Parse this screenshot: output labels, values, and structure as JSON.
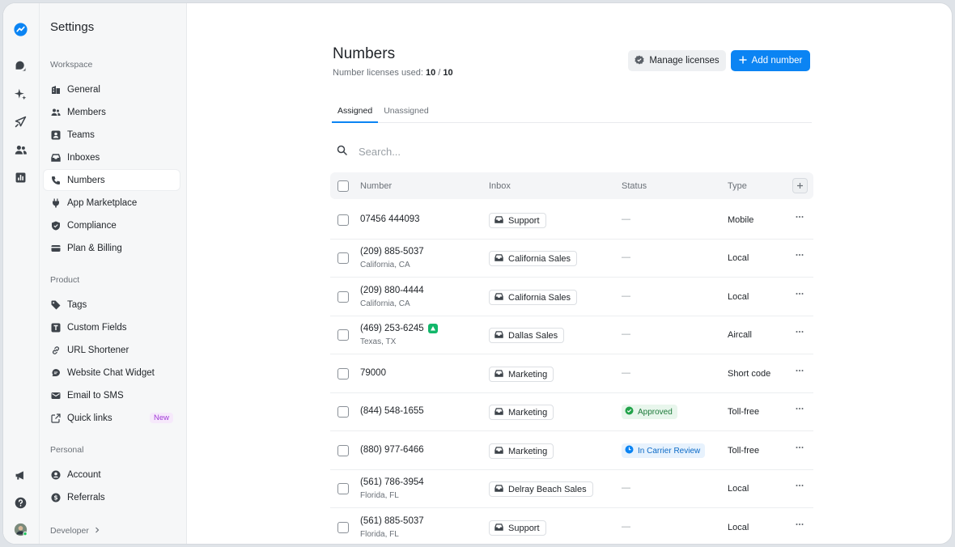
{
  "colors": {
    "accent": "#0b84f3",
    "approved": "#1d7a3a",
    "review": "#0b6ac7",
    "aircall": "#12b76a"
  },
  "rail": {
    "top_icons": [
      "app-logo-icon",
      "chat-bubbles-icon",
      "sparkle-icon",
      "rocket-icon",
      "contacts-icon",
      "analytics-icon"
    ],
    "bottom_icons": [
      "megaphone-icon",
      "help-icon",
      "user-avatar"
    ]
  },
  "sidebar": {
    "title": "Settings",
    "workspace_label": "Workspace",
    "workspace_items": [
      {
        "label": "General",
        "icon": "building-icon"
      },
      {
        "label": "Members",
        "icon": "members-icon"
      },
      {
        "label": "Teams",
        "icon": "teams-icon"
      },
      {
        "label": "Inboxes",
        "icon": "inbox-icon"
      },
      {
        "label": "Numbers",
        "icon": "phone-icon",
        "active": true
      },
      {
        "label": "App Marketplace",
        "icon": "plug-icon"
      },
      {
        "label": "Compliance",
        "icon": "shield-icon"
      },
      {
        "label": "Plan & Billing",
        "icon": "card-icon"
      }
    ],
    "product_label": "Product",
    "product_items": [
      {
        "label": "Tags",
        "icon": "tag-icon"
      },
      {
        "label": "Custom Fields",
        "icon": "custom-field-icon"
      },
      {
        "label": "URL Shortener",
        "icon": "link-icon"
      },
      {
        "label": "Website Chat Widget",
        "icon": "chat-widget-icon"
      },
      {
        "label": "Email to SMS",
        "icon": "email-icon"
      },
      {
        "label": "Quick links",
        "icon": "external-link-icon",
        "badge": "New"
      }
    ],
    "personal_label": "Personal",
    "personal_items": [
      {
        "label": "Account",
        "icon": "account-icon"
      },
      {
        "label": "Referrals",
        "icon": "dollar-icon"
      }
    ],
    "developer_label": "Developer"
  },
  "header": {
    "title": "Numbers",
    "licenses_prefix": "Number licenses used:",
    "licenses_used": "10",
    "licenses_separator": "/",
    "licenses_total": "10",
    "manage_licenses": "Manage licenses",
    "add_number": "Add number"
  },
  "tabs": [
    {
      "label": "Assigned",
      "active": true
    },
    {
      "label": "Unassigned",
      "active": false
    }
  ],
  "search": {
    "placeholder": "Search..."
  },
  "table": {
    "columns": [
      "Number",
      "Inbox",
      "Status",
      "Type"
    ],
    "rows": [
      {
        "number": "07456 444093",
        "location": "",
        "inbox": "Support",
        "status": "—",
        "status_kind": "none",
        "type": "Mobile"
      },
      {
        "number": "(209) 885-5037",
        "location": "California, CA",
        "inbox": "California Sales",
        "status": "—",
        "status_kind": "none",
        "type": "Local"
      },
      {
        "number": "(209) 880-4444",
        "location": "California, CA",
        "inbox": "California Sales",
        "status": "—",
        "status_kind": "none",
        "type": "Local"
      },
      {
        "number": "(469) 253-6245",
        "location": "Texas, TX",
        "inbox": "Dallas Sales",
        "status": "—",
        "status_kind": "none",
        "type": "Aircall",
        "aircall": true
      },
      {
        "number": "79000",
        "location": "",
        "inbox": "Marketing",
        "status": "—",
        "status_kind": "none",
        "type": "Short code"
      },
      {
        "number": "(844) 548-1655",
        "location": "",
        "inbox": "Marketing",
        "status": "Approved",
        "status_kind": "approved",
        "type": "Toll-free"
      },
      {
        "number": "(880) 977-6466",
        "location": "",
        "inbox": "Marketing",
        "status": "In Carrier Review",
        "status_kind": "review",
        "type": "Toll-free"
      },
      {
        "number": "(561) 786-3954",
        "location": "Florida, FL",
        "inbox": "Delray Beach Sales",
        "status": "—",
        "status_kind": "none",
        "type": "Local"
      },
      {
        "number": "(561) 885-5037",
        "location": "Florida, FL",
        "inbox": "Support",
        "status": "—",
        "status_kind": "none",
        "type": "Local"
      }
    ]
  }
}
